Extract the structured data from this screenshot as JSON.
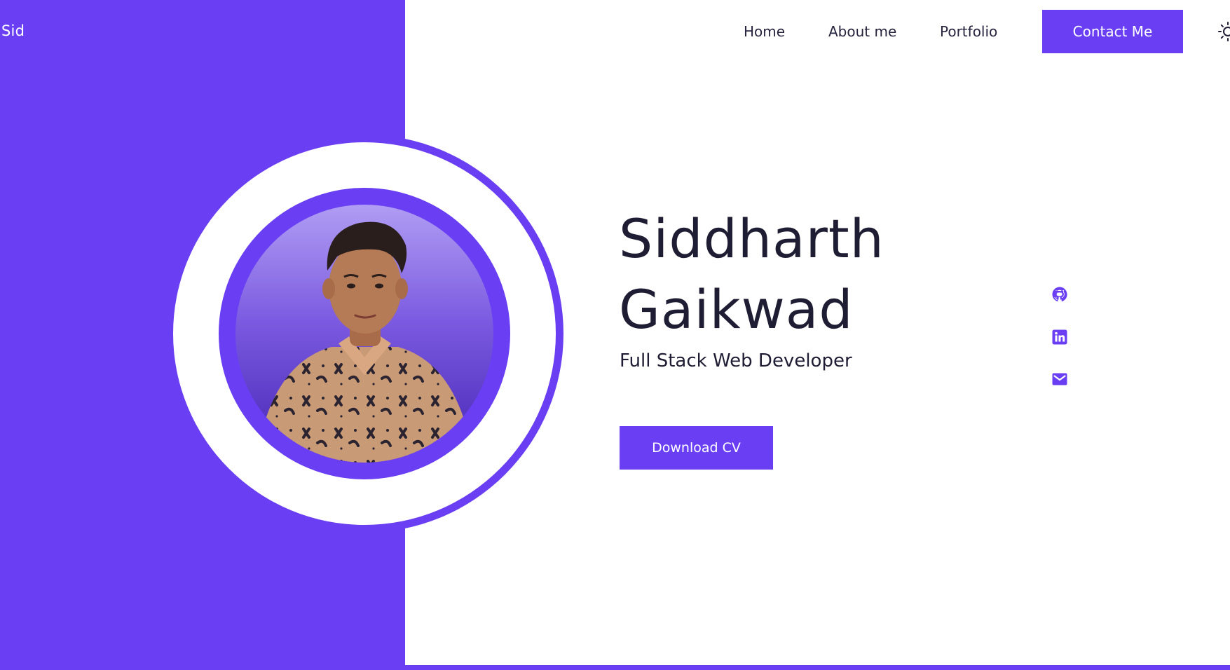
{
  "brand": {
    "logo": "Sid"
  },
  "nav": {
    "home": "Home",
    "about": "About me",
    "portfolio": "Portfolio",
    "contact": "Contact Me"
  },
  "hero": {
    "first_name": "Siddharth",
    "last_name": "Gaikwad",
    "role": "Full Stack Web Developer",
    "cta": "Download CV"
  },
  "icons": {
    "theme": "sun-icon",
    "social": [
      "github-icon",
      "linkedin-icon",
      "mail-icon"
    ]
  },
  "colors": {
    "accent": "#6a3ff3",
    "text": "#1f1d33",
    "background": "#ffffff"
  }
}
